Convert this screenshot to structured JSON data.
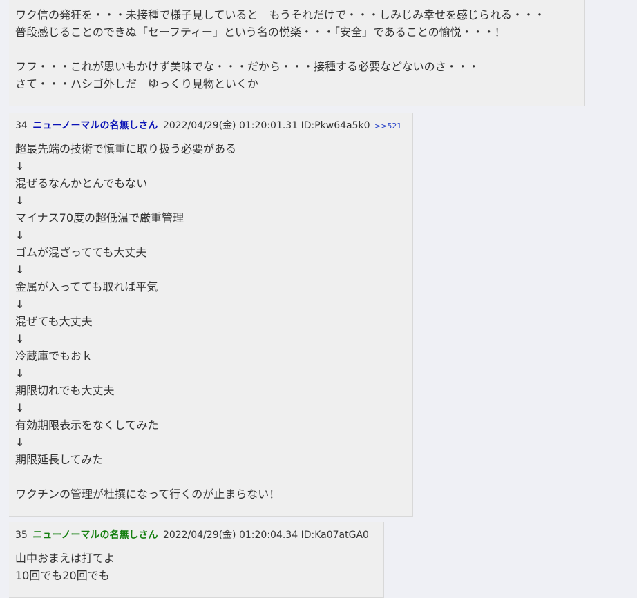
{
  "posts": [
    {
      "body": "ワク信の発狂を・・・未接種で様子見していると　もうそれだけで・・・しみじみ幸せを感じられる・・・\n普段感じることのできぬ「セーフティー」という名の悦楽・・・「安全」であることの愉悦・・・！\n\nフフ・・・これが思いもかけず美味でな・・・だから・・・接種する必要などないのさ・・・\nさて・・・ハシゴ外しだ　ゆっくり見物といくか"
    },
    {
      "number": "34",
      "name": "ニューノーマルの名無しさん",
      "datetime": "2022/04/29(金) 01:20:01.31",
      "id": "ID:Pkw64a5k0",
      "reply": ">>521",
      "body": "超最先端の技術で慎重に取り扱う必要がある\n↓\n混ぜるなんかとんでもない\n↓\nマイナス70度の超低温で厳重管理\n↓\nゴムが混ざってても大丈夫\n↓\n金属が入ってても取れば平気\n↓\n混ぜても大丈夫\n↓\n冷蔵庫でもおｋ\n↓\n期限切れでも大丈夫\n↓\n有効期限表示をなくしてみた\n↓\n期限延長してみた\n\nワクチンの管理が杜撰になって行くのが止まらない！"
    },
    {
      "number": "35",
      "name": "ニューノーマルの名無しさん",
      "datetime": "2022/04/29(金) 01:20:04.34",
      "id": "ID:Ka07atGA0",
      "body": "山中おまえは打てよ\n10回でも20回でも"
    }
  ]
}
